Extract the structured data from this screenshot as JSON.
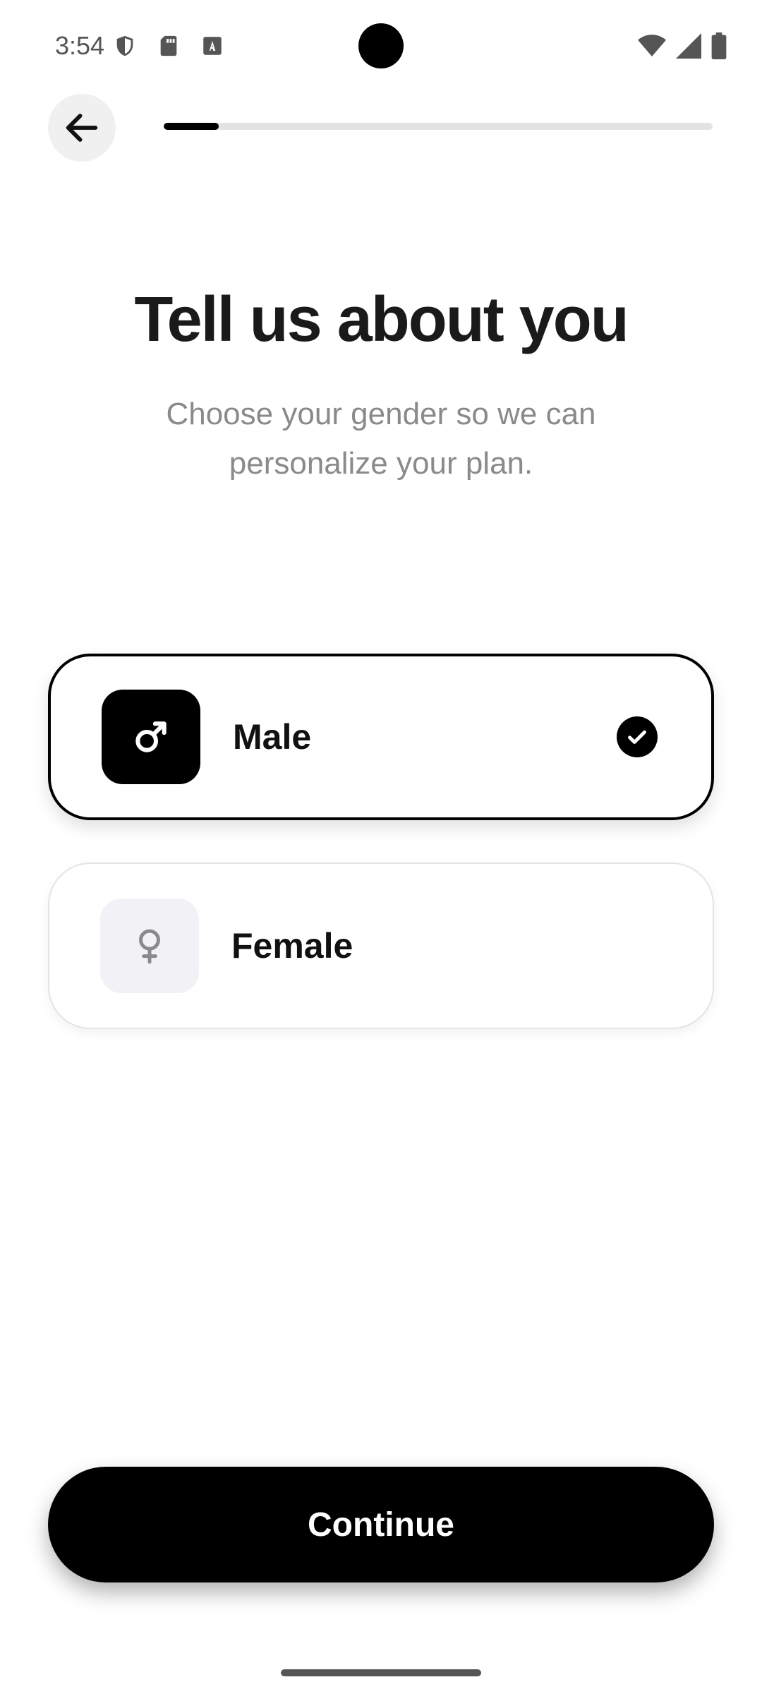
{
  "status_bar": {
    "time": "3:54",
    "left_icons": [
      "shield-icon",
      "sd-card-icon",
      "font-download-icon"
    ],
    "right_icons": [
      "wifi-icon",
      "signal-icon",
      "battery-icon"
    ]
  },
  "header": {
    "back_icon": "arrow-left-icon",
    "progress": 0.1
  },
  "title": "Tell us about you",
  "subtitle": "Choose your gender so we can personalize your plan.",
  "options": [
    {
      "label": "Male",
      "icon": "male-symbol-icon",
      "selected": true
    },
    {
      "label": "Female",
      "icon": "female-symbol-icon",
      "selected": false
    }
  ],
  "continue_label": "Continue",
  "colors": {
    "primary": "#000000",
    "track": "#e3e3e3",
    "subtitle": "#8a8a8a",
    "unselected_icon_bg": "#f2f2f6"
  }
}
